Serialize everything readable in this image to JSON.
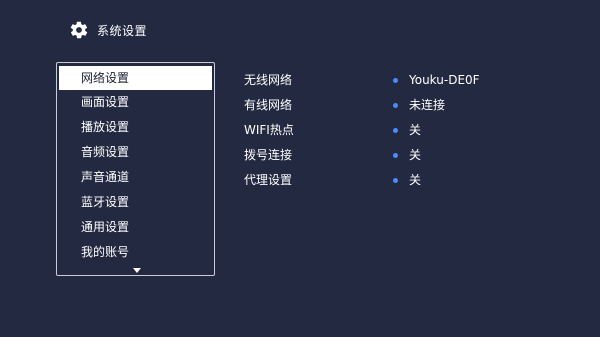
{
  "header": {
    "title": "系统设置",
    "icon": "gear-icon"
  },
  "menu": {
    "items": [
      {
        "label": "网络设置",
        "selected": true
      },
      {
        "label": "画面设置"
      },
      {
        "label": "播放设置"
      },
      {
        "label": "音频设置"
      },
      {
        "label": "声音通道"
      },
      {
        "label": "蓝牙设置"
      },
      {
        "label": "通用设置"
      },
      {
        "label": "我的账号"
      }
    ],
    "more_indicator": "chevron-down-icon"
  },
  "network": {
    "rows": [
      {
        "label": "无线网络",
        "value": "Youku-DE0F"
      },
      {
        "label": "有线网络",
        "value": "未连接"
      },
      {
        "label": "WIFI热点",
        "value": "关"
      },
      {
        "label": "拨号连接",
        "value": "关"
      },
      {
        "label": "代理设置",
        "value": "关"
      }
    ]
  },
  "colors": {
    "background": "#232940",
    "accent_dot": "#4a8bff",
    "selected_bg": "#ffffff"
  }
}
